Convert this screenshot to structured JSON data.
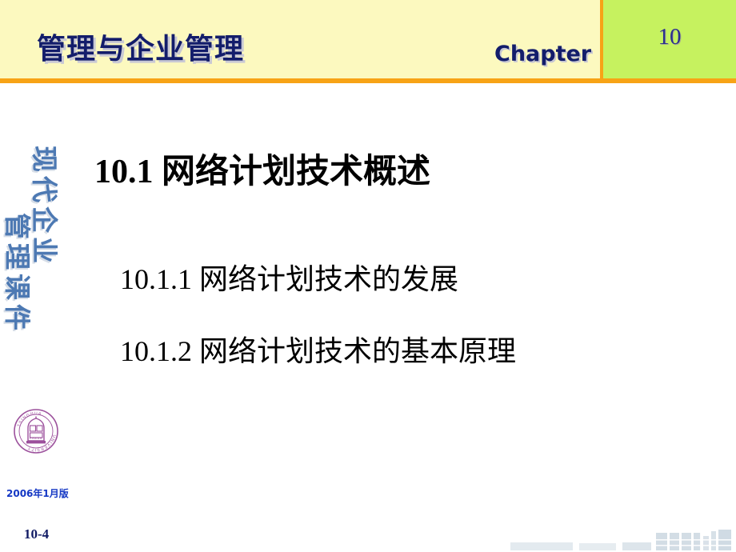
{
  "header": {
    "title": "管理与企业管理",
    "chapter_label": "Chapter",
    "chapter_number": "10",
    "band_color": "#fcf9bf",
    "rule_color": "#f7a316",
    "chapter_box_color": "#c6f25f",
    "title_color": "#131d6b"
  },
  "watermark": {
    "column_a": "现代企业",
    "column_b": "管理课件",
    "color": "#3e6ead"
  },
  "body": {
    "section_title": "10.1  网络计划技术概述",
    "sub_items": [
      {
        "label": "10.1.1  网络计划技术的发展"
      },
      {
        "label": "10.1.2  网络计划技术的基本原理"
      }
    ],
    "text_color": "#000000"
  },
  "logo": {
    "name": "tsinghua-university-seal",
    "ring_text_top": "TSINGHUA",
    "ring_text_bottom": "UNIVERSITY",
    "plate_text": "PRESS",
    "color": "#9c509c"
  },
  "footer": {
    "edition": "2006年1月版",
    "edition_color": "#1437c4",
    "page_number": "10-4",
    "page_number_color": "#101a64"
  },
  "decoration": {
    "skyline_color": "#b6c7d4"
  }
}
